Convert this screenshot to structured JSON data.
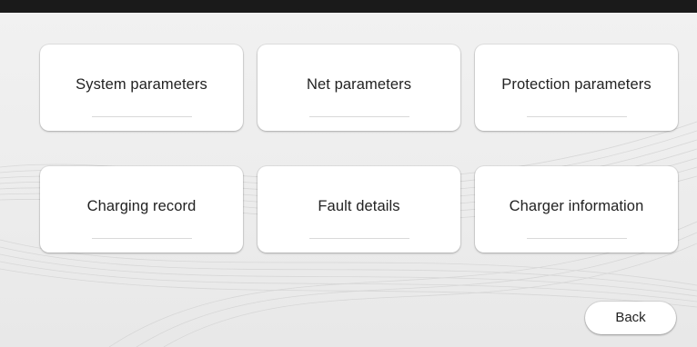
{
  "menu": {
    "items": [
      {
        "label": "System parameters"
      },
      {
        "label": "Net parameters"
      },
      {
        "label": "Protection parameters"
      },
      {
        "label": "Charging record"
      },
      {
        "label": "Fault details"
      },
      {
        "label": "Charger information"
      }
    ]
  },
  "footer": {
    "back_label": "Back"
  }
}
